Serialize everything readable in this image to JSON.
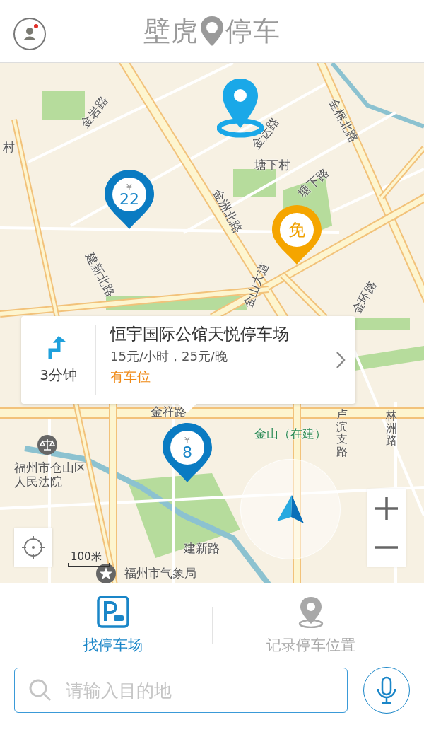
{
  "header": {
    "logo_left": "壁虎",
    "logo_right": "停车",
    "notification": true
  },
  "map": {
    "labels": [
      {
        "text": "塘下村",
        "kind": "place"
      },
      {
        "text": "村",
        "kind": "place"
      },
      {
        "text": "金祥路",
        "kind": "place"
      },
      {
        "text": "金山（在建）",
        "kind": "green"
      },
      {
        "text": "福州市仓山区人民法院",
        "kind": "poi"
      },
      {
        "text": "建新路",
        "kind": "place"
      },
      {
        "text": "福州市气象局",
        "kind": "poi"
      },
      {
        "text": "金岩路",
        "kind": "road"
      },
      {
        "text": "金达路",
        "kind": "road"
      },
      {
        "text": "金榕北路",
        "kind": "road"
      },
      {
        "text": "金洲北路",
        "kind": "road"
      },
      {
        "text": "塘下路",
        "kind": "road"
      },
      {
        "text": "建新北路",
        "kind": "road"
      },
      {
        "text": "金山大道",
        "kind": "road"
      },
      {
        "text": "金环路",
        "kind": "road"
      },
      {
        "text": "卢滨支路",
        "kind": "vertical"
      },
      {
        "text": "林洲路",
        "kind": "vertical"
      }
    ],
    "pins": [
      {
        "kind": "price",
        "currency": "¥",
        "value": "22"
      },
      {
        "kind": "free",
        "value": "免"
      },
      {
        "kind": "price",
        "currency": "¥",
        "value": "8"
      }
    ],
    "scale": "100米"
  },
  "callout": {
    "eta": "3分钟",
    "name": "恒宇国际公馆天悦停车场",
    "price": "15元/小时，25元/晚",
    "status": "有车位"
  },
  "tabs": [
    {
      "label": "找停车场",
      "selected": true,
      "kind": "parking"
    },
    {
      "label": "记录停车位置",
      "selected": false,
      "kind": "record"
    }
  ],
  "search": {
    "placeholder": "请输入目的地"
  }
}
